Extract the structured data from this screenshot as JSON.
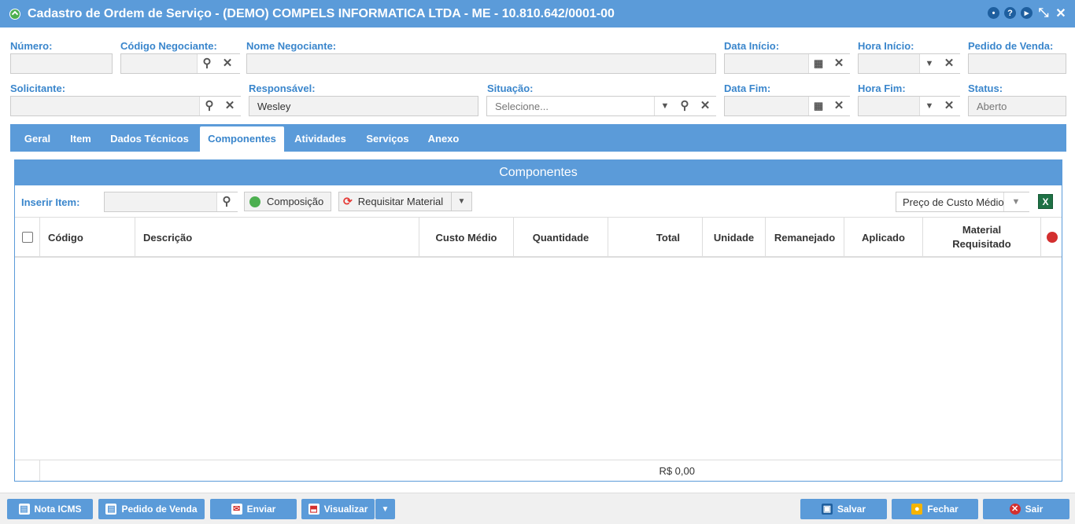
{
  "window": {
    "title": "Cadastro de Ordem de Serviço - (DEMO) COMPELS INFORMATICA LTDA - ME - 10.810.642/0001-00"
  },
  "form": {
    "numero_label": "Número:",
    "codigo_negociante_label": "Código Negociante:",
    "nome_negociante_label": "Nome Negociante:",
    "data_inicio_label": "Data Início:",
    "hora_inicio_label": "Hora Início:",
    "pedido_venda_label": "Pedido de Venda:",
    "solicitante_label": "Solicitante:",
    "responsavel_label": "Responsável:",
    "responsavel_value": "Wesley",
    "situacao_label": "Situação:",
    "situacao_placeholder": "Selecione...",
    "data_fim_label": "Data Fim:",
    "hora_fim_label": "Hora Fim:",
    "status_label": "Status:",
    "status_value": "Aberto"
  },
  "tabs": [
    "Geral",
    "Item",
    "Dados Técnicos",
    "Componentes",
    "Atividades",
    "Serviços",
    "Anexo"
  ],
  "panel": {
    "title": "Componentes",
    "inserir_item_label": "Inserir Item:",
    "composicao_button": "Composição",
    "requisitar_button": "Requisitar Material",
    "price_select": "Preço de Custo Médio",
    "columns": {
      "codigo": "Código",
      "descricao": "Descrição",
      "custo_medio": "Custo Médio",
      "quantidade": "Quantidade",
      "total": "Total",
      "unidade": "Unidade",
      "remanejado": "Remanejado",
      "aplicado": "Aplicado",
      "material_requisitado_1": "Material",
      "material_requisitado_2": "Requisitado"
    },
    "total_value": "R$ 0,00"
  },
  "bottom": {
    "nota_icms": "Nota ICMS",
    "pedido_venda": "Pedido de Venda",
    "enviar": "Enviar",
    "visualizar": "Visualizar",
    "salvar": "Salvar",
    "fechar": "Fechar",
    "sair": "Sair"
  },
  "colors": {
    "accent": "#5b9bd9",
    "label": "#3a86cc",
    "field_bg": "#f2f2f2"
  }
}
